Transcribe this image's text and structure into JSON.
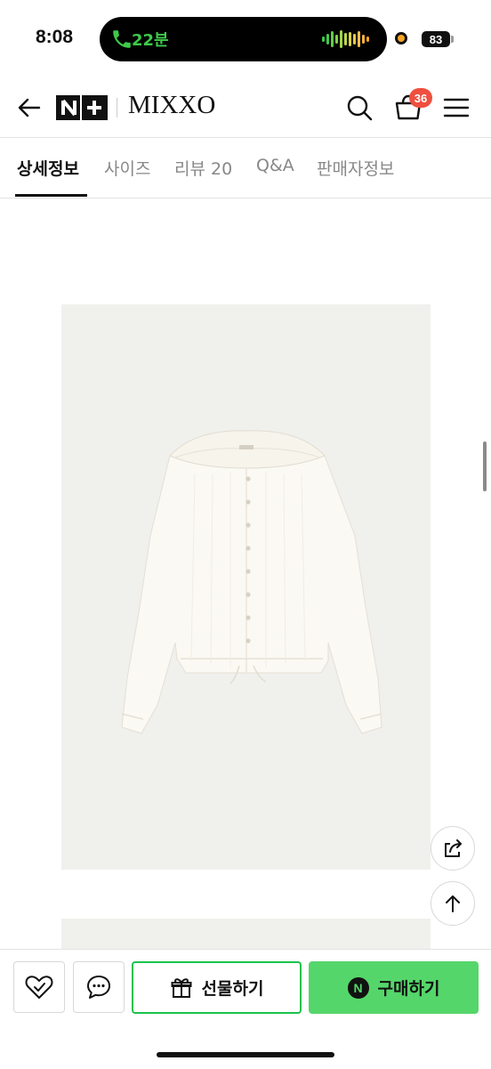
{
  "status_bar": {
    "time": "8:08",
    "call_duration": "22분",
    "battery": "83"
  },
  "header": {
    "logo_text": "N+",
    "brand": "MIXXO",
    "cart_count": "36"
  },
  "tabs": [
    {
      "label": "상세정보",
      "active": true
    },
    {
      "label": "사이즈",
      "active": false
    },
    {
      "label": "리뷰 20",
      "active": false
    },
    {
      "label": "Q&A",
      "active": false
    },
    {
      "label": "판매자정보",
      "active": false
    }
  ],
  "bottom_bar": {
    "gift_label": "선물하기",
    "buy_label": "구매하기",
    "buy_icon_letter": "N"
  },
  "colors": {
    "accent_green": "#55d66a",
    "gift_border": "#19c34d",
    "badge_red": "#ef4f3f"
  },
  "icons": [
    "back-arrow-icon",
    "search-icon",
    "cart-icon",
    "menu-icon",
    "share-icon",
    "arrow-up-icon",
    "heart-check-icon",
    "chat-bubble-icon",
    "gift-icon"
  ]
}
